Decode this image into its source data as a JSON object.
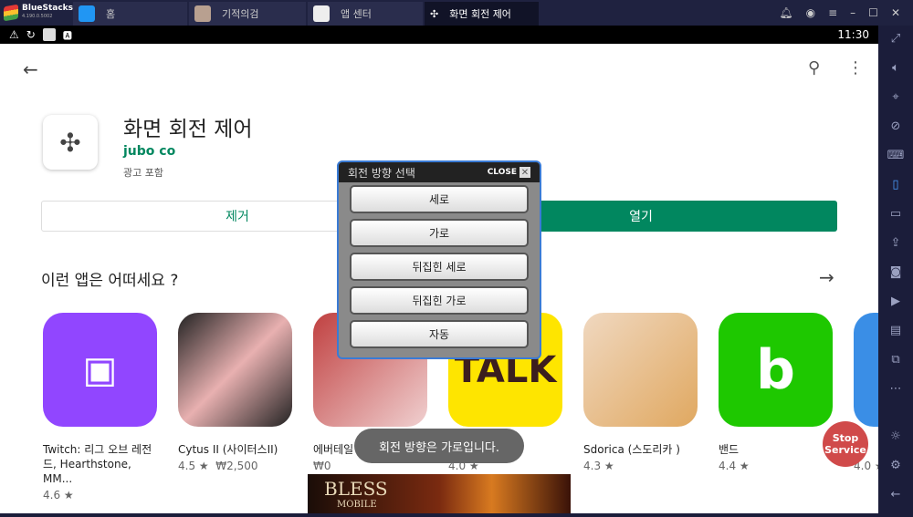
{
  "titlebar": {
    "brand": "BlueStacks",
    "version": "4.190.0.5002",
    "tabs": [
      {
        "label": "홈",
        "icon": "home-icon"
      },
      {
        "label": "기적의검",
        "icon": "game-icon"
      },
      {
        "label": "앱 센터",
        "icon": "app-center-icon"
      },
      {
        "label": "화면 회전 제어",
        "icon": "rotation-control-icon",
        "active": true
      }
    ],
    "controls": [
      "bell-icon",
      "account-icon",
      "menu-icon",
      "minimize-icon",
      "maximize-icon",
      "close-icon"
    ]
  },
  "statusbar": {
    "time": "11:30"
  },
  "app": {
    "title": "화면 회전 제어",
    "developer": "jubo co",
    "ads": "광고 포함",
    "remove": "제거",
    "open": "열기"
  },
  "section": {
    "title": "이런 앱은 어떠세요 ?"
  },
  "apps": [
    {
      "name": "Twitch: 리그 오브 레전드, Hearthstone, MM...",
      "rating": "4.6 ★",
      "price": "",
      "color": "#9146ff"
    },
    {
      "name": "Cytus II (사이터스II)",
      "rating": "4.5 ★",
      "price": "₩2,500",
      "color": "#333"
    },
    {
      "name": "에버테일",
      "rating": "",
      "price": "₩0",
      "color": "#c04040"
    },
    {
      "name": "KakaoTalk",
      "rating": "4.0 ★",
      "price": "",
      "color": "#fee500"
    },
    {
      "name": "Sdorica (스도리카 )",
      "rating": "4.3 ★",
      "price": "",
      "color": "#e8c8a8"
    },
    {
      "name": "밴드",
      "rating": "4.4 ★",
      "price": "",
      "color": "#1ec800"
    },
    {
      "name": "",
      "rating": "4.0 ★",
      "price": "",
      "color": "#3a8ee6"
    }
  ],
  "dialog": {
    "title": "회전 방향 선택",
    "close": "CLOSE",
    "options": [
      "세로",
      "가로",
      "뒤집힌 세로",
      "뒤집힌 가로",
      "자동"
    ]
  },
  "toast": "회전 방향은 가로입니다.",
  "stop_service": "Stop Service",
  "banner": {
    "title": "BLESS",
    "subtitle": "MOBILE"
  },
  "icons": {
    "kakao": "TALK"
  }
}
